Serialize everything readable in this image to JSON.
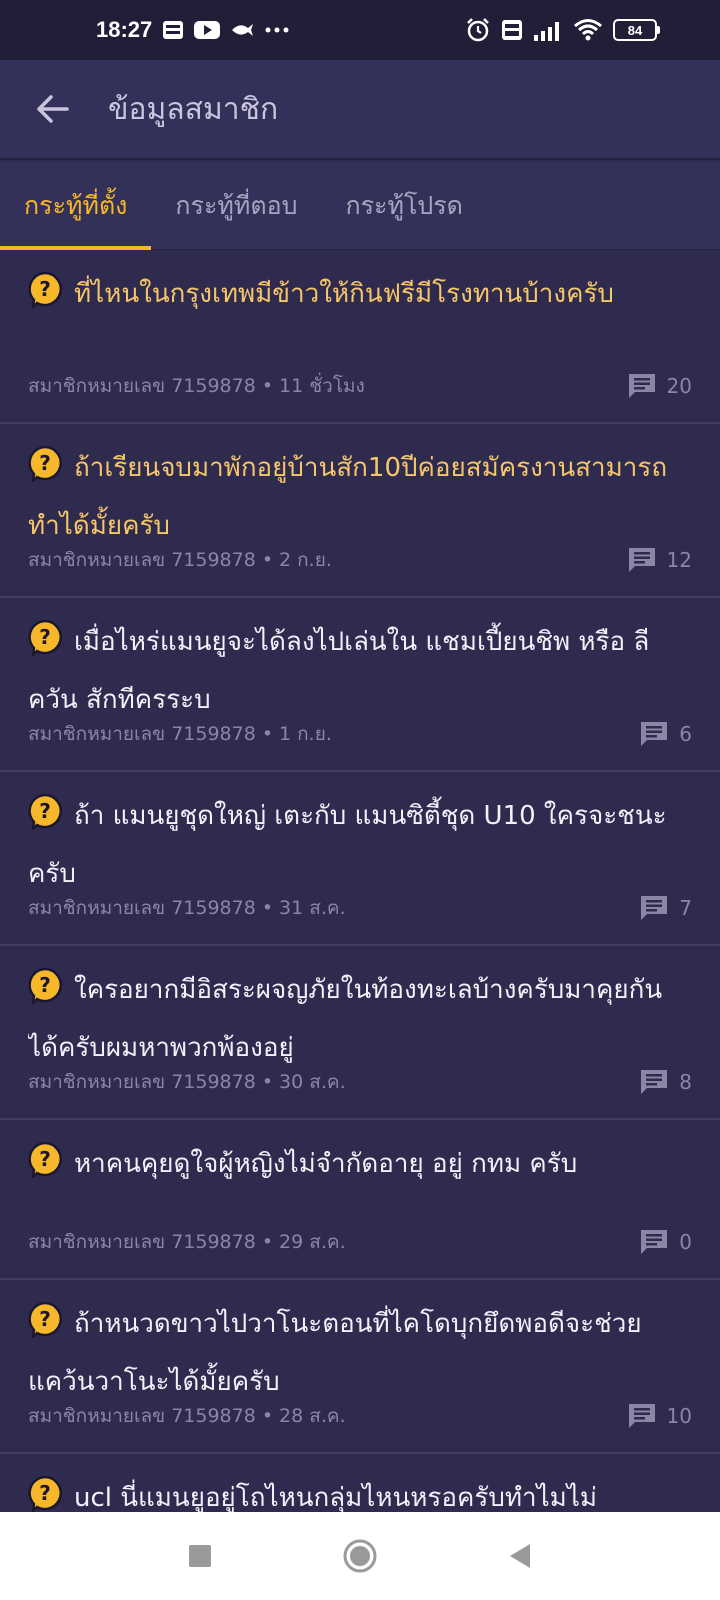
{
  "status_bar": {
    "time": "18:27",
    "battery": "84",
    "icons": [
      "webtoon-icon",
      "youtube-icon",
      "fish-icon",
      "more-icon",
      "alarm-icon",
      "volte-icon",
      "signal-icon",
      "wifi-icon",
      "battery-icon"
    ]
  },
  "app_bar": {
    "title": "ข้อมูลสมาชิก"
  },
  "tabs": [
    {
      "label": "กระทู้ที่ตั้ง",
      "active": true
    },
    {
      "label": "กระทู้ที่ตอบ",
      "active": false
    },
    {
      "label": "กระทู้โปรด",
      "active": false
    }
  ],
  "topics": [
    {
      "title": "ที่ไหนในกรุงเทพมีข้าวให้กินฟรีมีโรงทานบ้างครับ",
      "member": "สมาชิกหมายเลข 7159878",
      "time": "11 ชั่วโมง",
      "comments": "20",
      "unread": true
    },
    {
      "title": "ถ้าเรียนจบมาพักอยู่บ้านสัก10ปีค่อยสมัครงานสามารถทำได้มั้ยครับ",
      "member": "สมาชิกหมายเลข 7159878",
      "time": "2 ก.ย.",
      "comments": "12",
      "unread": true
    },
    {
      "title": "เมื่อไหร่แมนยูจะได้ลงไปเล่นใน แชมเปี้ยนชิพ หรือ ลีควัน สักทีครระบ",
      "member": "สมาชิกหมายเลข 7159878",
      "time": "1 ก.ย.",
      "comments": "6",
      "unread": false
    },
    {
      "title": "ถ้า แมนยูชุดใหญ่ เตะกับ แมนซิตี้ชุด U10 ใครจะชนะครับ",
      "member": "สมาชิกหมายเลข 7159878",
      "time": "31 ส.ค.",
      "comments": "7",
      "unread": false
    },
    {
      "title": "ใครอยากมีอิสระผจญภัยในท้องทะเลบ้างครับมาคุยกันได้ครับผมหาพวกพ้องอยู่",
      "member": "สมาชิกหมายเลข 7159878",
      "time": "30 ส.ค.",
      "comments": "8",
      "unread": false
    },
    {
      "title": "หาคนคุยดูใจผู้หญิงไม่จำกัดอายุ อยู่ กทม ครับ",
      "member": "สมาชิกหมายเลข 7159878",
      "time": "29 ส.ค.",
      "comments": "0",
      "unread": false
    },
    {
      "title": "ถ้าหนวดขาวไปวาโนะตอนที่ไคโดบุกยึดพอดีจะช่วยแคว้นวาโนะได้มั้ยครับ",
      "member": "สมาชิกหมายเลข 7159878",
      "time": "28 ส.ค.",
      "comments": "10",
      "unread": false
    },
    {
      "title": "ucl นี่แมนยูอยู่โถไหนกลุ่มไหนหรอครับทำไมไม่",
      "member": "",
      "time": "",
      "comments": "",
      "unread": false
    }
  ],
  "colors": {
    "background": "#2f2b4f",
    "accent": "#f6b72a",
    "unread_title": "#f6c66a",
    "meta": "#8a86a6"
  }
}
